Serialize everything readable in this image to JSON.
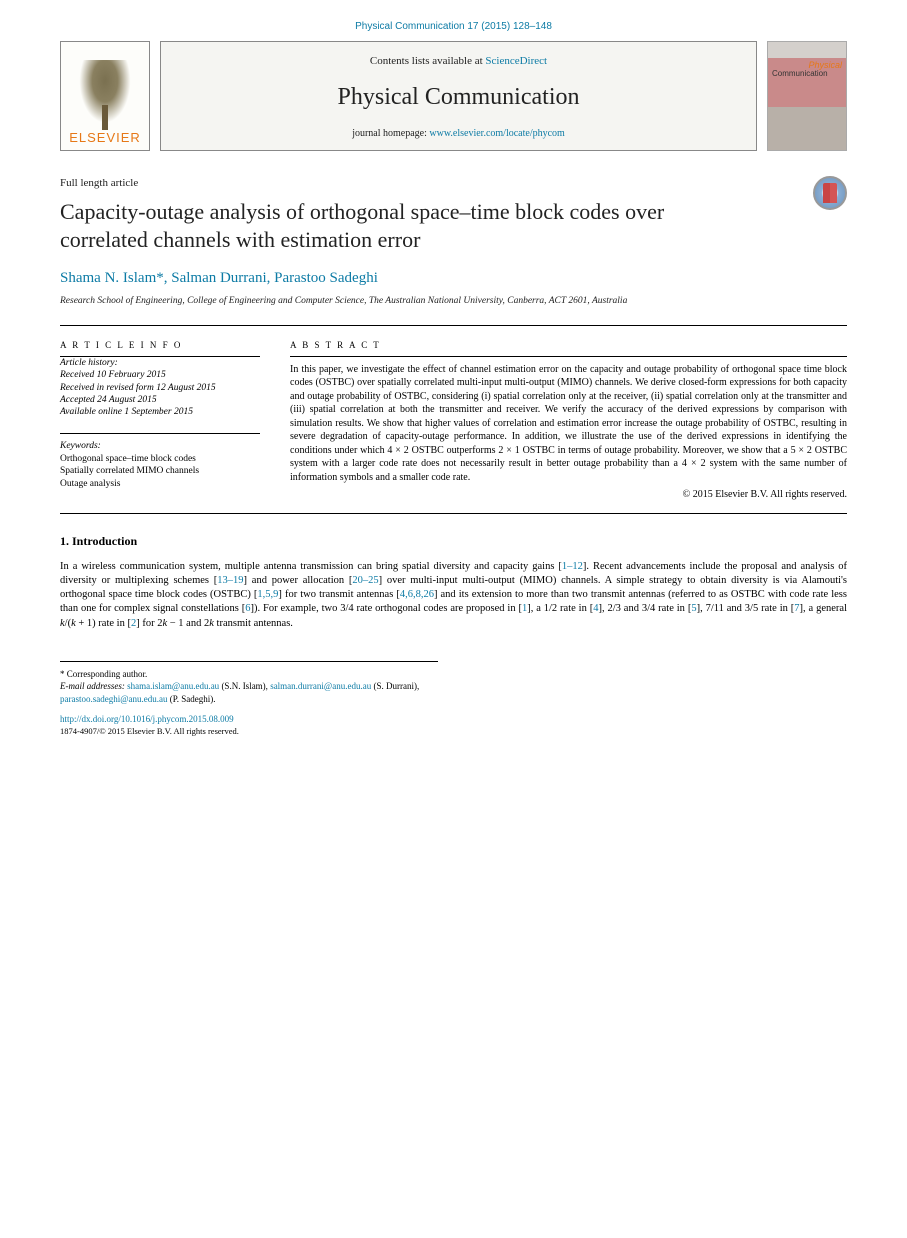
{
  "header": {
    "journal_ref": "Physical Communication 17 (2015) 128–148"
  },
  "banner": {
    "elsevier": "ELSEVIER",
    "contents_prefix": "Contents lists available at ",
    "contents_link": "ScienceDirect",
    "journal_title": "Physical Communication",
    "homepage_prefix": "journal homepage: ",
    "homepage_link": "www.elsevier.com/locate/phycom",
    "cover_t1": "Physical",
    "cover_t2": "Communication"
  },
  "article": {
    "type_label": "Full length article",
    "title": "Capacity-outage analysis of orthogonal space–time block codes over correlated channels with estimation error",
    "authors": "Shama N. Islam*, Salman Durrani, Parastoo Sadeghi",
    "affiliation": "Research School of Engineering, College of Engineering and Computer Science, The Australian National University, Canberra, ACT 2601, Australia"
  },
  "info": {
    "article_info_label": "A R T I C L E   I N F O",
    "history": "Article history:\nReceived 10 February 2015\nReceived in revised form 12 August 2015\nAccepted 24 August 2015\nAvailable online 1 September 2015",
    "keywords_label": "Keywords:",
    "keywords": "Orthogonal space–time block codes\nSpatially correlated MIMO channels\nOutage analysis"
  },
  "abstract": {
    "label": "A B S T R A C T",
    "text": "In this paper, we investigate the effect of channel estimation error on the capacity and outage probability of orthogonal space time block codes (OSTBC) over spatially correlated multi-input multi-output (MIMO) channels. We derive closed-form expressions for both capacity and outage probability of OSTBC, considering (i) spatial correlation only at the receiver, (ii) spatial correlation only at the transmitter and (iii) spatial correlation at both the transmitter and receiver. We verify the accuracy of the derived expressions by comparison with simulation results. We show that higher values of correlation and estimation error increase the outage probability of OSTBC, resulting in severe degradation of capacity-outage performance. In addition, we illustrate the use of the derived expressions in identifying the conditions under which 4 × 2 OSTBC outperforms 2 × 1 OSTBC in terms of outage probability. Moreover, we show that a 5 × 2 OSTBC system with a larger code rate does not necessarily result in better outage probability than a 4 × 2 system with the same number of information symbols and a smaller code rate.",
    "copyright": "© 2015 Elsevier B.V. All rights reserved."
  },
  "introduction": {
    "heading": "1. Introduction",
    "paragraph": "In a wireless communication system, multiple antenna transmission can bring spatial diversity and capacity gains [1–12]. Recent advancements include the proposal and analysis of diversity or multiplexing schemes [13–19] and power allocation [20–25] over multi-input multi-output (MIMO) channels. A simple strategy to obtain diversity is via Alamouti's orthogonal space time block codes (OSTBC) [1,5,9] for two transmit antennas [4,6,8,26] and its extension to more than two transmit antennas (referred to as OSTBC with code rate less than one for complex signal constellations [6]). For example, two 3/4 rate orthogonal codes are proposed in [1], a 1/2 rate in [4], 2/3 and 3/4 rate in [5], 7/11 and 3/5 rate in [7], a general k/(k + 1) rate in [2] for 2k − 1 and 2k transmit antennas."
  },
  "footnotes": {
    "corr_label": "* Corresponding author.",
    "emails_label": "E-mail addresses: ",
    "email1": "shama.islam@anu.edu.au",
    "name1": " (S.N. Islam), ",
    "email2": "salman.durrani@anu.edu.au",
    "name2": " (S. Durrani), ",
    "email3": "parastoo.sadeghi@anu.edu.au",
    "name3": " (P. Sadeghi)."
  },
  "doi": {
    "url": "http://dx.doi.org/10.1016/j.phycom.2015.08.009",
    "pub": "1874-4907/© 2015 Elsevier B.V. All rights reserved."
  }
}
